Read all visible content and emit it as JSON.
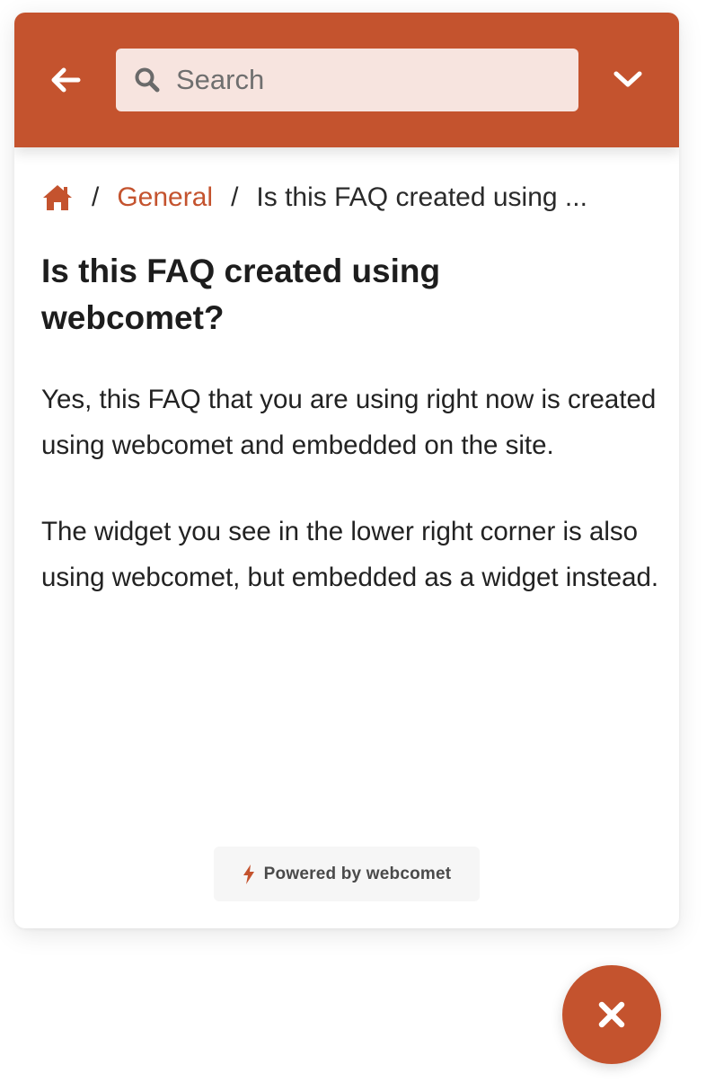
{
  "colors": {
    "accent": "#c4532e",
    "search_bg": "#f7e4df",
    "text": "#222222"
  },
  "header": {
    "back_icon": "arrow-left-icon",
    "search": {
      "placeholder": "Search",
      "value": "",
      "icon": "search-icon"
    },
    "dropdown_icon": "chevron-down-icon"
  },
  "breadcrumb": {
    "home_icon": "home-icon",
    "separator": "/",
    "category": "General",
    "current": "Is this FAQ created using ..."
  },
  "article": {
    "title": "Is this FAQ created using webcomet?",
    "paragraphs": [
      "Yes, this FAQ that you are using right now is created using webcomet and embedded on the site.",
      "The widget you see in the lower right corner is also using webcomet, but embedded as a widget instead."
    ]
  },
  "footer": {
    "powered_icon": "bolt-icon",
    "powered_label": "Powered by webcomet"
  },
  "launcher": {
    "close_icon": "close-icon"
  }
}
